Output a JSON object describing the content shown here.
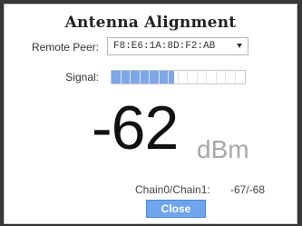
{
  "dialog": {
    "title": "Antenna Alignment",
    "remote_peer_label": "Remote Peer:",
    "remote_peer_value": "F8:E6:1A:8D:F2:AB",
    "signal_label": "Signal:",
    "signal_level_fraction": 0.47,
    "rssi_value": "-62",
    "rssi_unit": "dBm",
    "chain_label": "Chain0/Chain1:",
    "chain_values": "-67/-68",
    "close_label": "Close"
  },
  "icons": {
    "dropdown": "chevron-down-icon"
  },
  "colors": {
    "signal_fill": "#7ea7e8",
    "button_bg": "#6fa5ec"
  }
}
